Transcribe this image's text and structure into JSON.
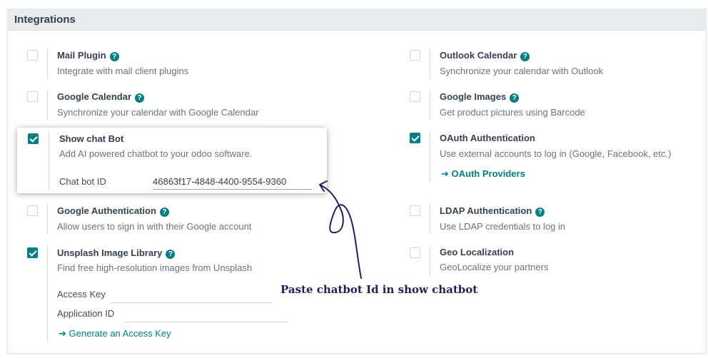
{
  "section": {
    "title": "Integrations"
  },
  "settings": {
    "mail_plugin": {
      "title": "Mail Plugin",
      "desc": "Integrate with mail client plugins"
    },
    "outlook_calendar": {
      "title": "Outlook Calendar",
      "desc": "Synchronize your calendar with Outlook"
    },
    "google_calendar": {
      "title": "Google Calendar",
      "desc": "Synchronize your calendar with Google Calendar"
    },
    "google_images": {
      "title": "Google Images",
      "desc": "Get product pictures using Barcode"
    },
    "show_chat_bot": {
      "title": "Show chat Bot",
      "desc": "Add AI powered chatbot to your odoo software.",
      "field_label": "Chat bot ID",
      "field_value": "46863f17-4848-4400-9554-9360"
    },
    "oauth": {
      "title": "OAuth Authentication",
      "desc": "Use external accounts to log in (Google, Facebook, etc.)",
      "link": "OAuth Providers"
    },
    "google_auth": {
      "title": "Google Authentication",
      "desc": "Allow users to sign in with their Google account"
    },
    "ldap": {
      "title": "LDAP Authentication",
      "desc": "Use LDAP credentials to log in"
    },
    "unsplash": {
      "title": "Unsplash Image Library",
      "desc": "Find free high-resolution images from Unsplash",
      "access_key_label": "Access Key",
      "application_id_label": "Application ID",
      "link": "Generate an Access Key"
    },
    "geo": {
      "title": "Geo Localization",
      "desc": "GeoLocalize your partners"
    }
  },
  "annotation": {
    "text": "Paste chatbot Id in show chatbot",
    "color": "#22205a"
  },
  "colors": {
    "accent": "#017e84",
    "header_bg": "#e9ecef"
  },
  "icons": {
    "help": "question-circle-icon",
    "arrow": "arrow-right-icon"
  }
}
